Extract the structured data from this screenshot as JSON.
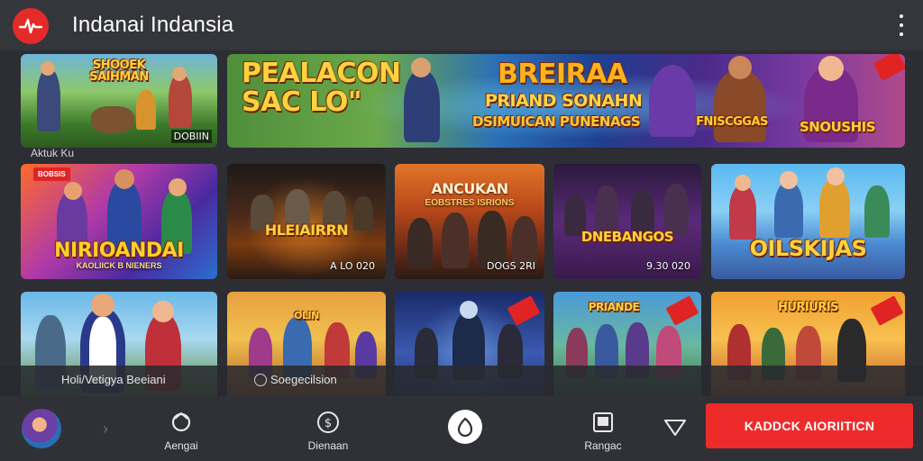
{
  "header": {
    "title": "Indanai Indansia",
    "logo_icon": "heartbeat-logo-icon",
    "menu_icon": "kebab-menu-icon",
    "accent": "#e52a2a"
  },
  "banners": [
    {
      "title": "SHOOEK SAIHMAN",
      "tag": "DOBIIN",
      "caption": "Aktuk Ku"
    },
    {
      "title": "PEALACON SAC LO\"",
      "subtitle_1": "BREIRAA",
      "subtitle_2": "PRIAND SONAHN",
      "subtitle_3": "DSIMUICAN PUNENAGS",
      "tag_1": "FNISCGGAS",
      "tag_2": "SNOUSHIS"
    }
  ],
  "row1": [
    {
      "title": "NIRIOANDAI",
      "subtitle": "KAOLIICK B NIENERS",
      "badge": "BOBSIS"
    },
    {
      "title": "HLEIAIRRN",
      "tag": "A LO 020"
    },
    {
      "title": "ANCUKAN",
      "subtitle": "EOBSTRES ISRIONS",
      "tag": "DOGS 2RI"
    },
    {
      "title": "DNEBANGOS",
      "tag": "9.30 020"
    },
    {
      "title": "OILSKIJAS"
    }
  ],
  "row2": [
    {
      "title": ""
    },
    {
      "title": "OLIN"
    },
    {
      "title": ""
    },
    {
      "title": "PRIANDE"
    },
    {
      "title": "HURIURIS"
    }
  ],
  "info_strip": {
    "left_text": "Holi/Vetigya Beeiani",
    "right_text": "Soegecilsion"
  },
  "bottom_nav": {
    "items": [
      {
        "label": "Aengai",
        "icon": "crown-icon"
      },
      {
        "label": "Dienaan",
        "icon": "coin-icon"
      },
      {
        "label": "Rangac",
        "icon": "gallery-icon"
      }
    ],
    "cta_label": "KADDCK AIORIITICN",
    "cta_color": "#ee2b2b"
  }
}
